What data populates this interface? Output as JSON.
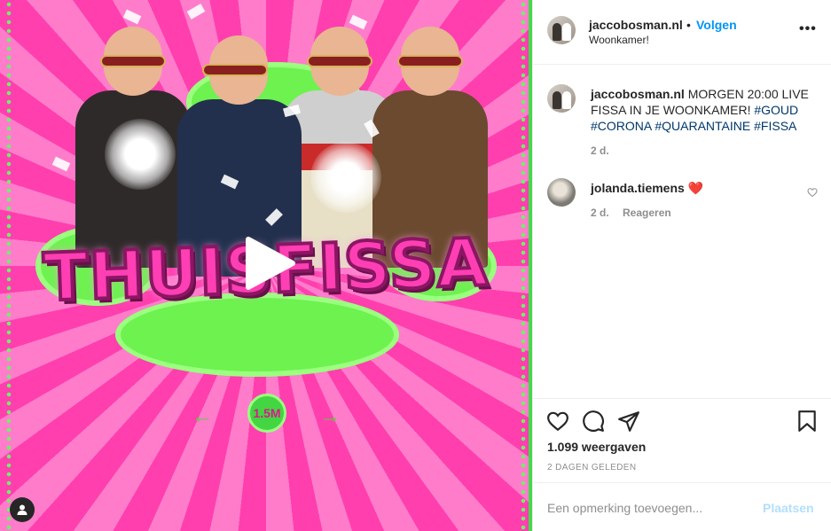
{
  "post": {
    "username": "jaccobosman.nl",
    "separator": "•",
    "follow_label": "Volgen",
    "location": "Woonkamer!",
    "more_label": "•••"
  },
  "media": {
    "title_text": "THUISFISSA",
    "views_badge": "1.5M",
    "arrow_left": "←",
    "arrow_right": "→",
    "play_icon": "play-icon",
    "user_tag_icon": "user-tag-icon"
  },
  "caption": {
    "username": "jaccobosman.nl",
    "text": "MORGEN 20:00 LIVE FISSA IN JE WOONKAMER!",
    "hashtags": [
      "#GOUD",
      "#CORONA",
      "#QUARANTAINE",
      "#FISSA"
    ],
    "age": "2 d."
  },
  "comments": [
    {
      "username": "jolanda.tiemens",
      "text": "❤️",
      "age": "2 d.",
      "reply_label": "Reageren"
    }
  ],
  "actions": {
    "like_icon": "heart-icon",
    "comment_icon": "comment-icon",
    "share_icon": "share-icon",
    "save_icon": "bookmark-icon"
  },
  "stats": {
    "views": "1.099 weergaven",
    "posted": "2 DAGEN GELEDEN"
  },
  "add_comment": {
    "placeholder": "Een opmerking toevoegen...",
    "submit_label": "Plaatsen"
  },
  "colors": {
    "link_blue": "#0095f6",
    "hashtag": "#00376b",
    "muted": "#8e8e8e",
    "submit_disabled": "#b2dffc",
    "media_pink": "#ff3fae",
    "media_green": "#6df24f"
  }
}
